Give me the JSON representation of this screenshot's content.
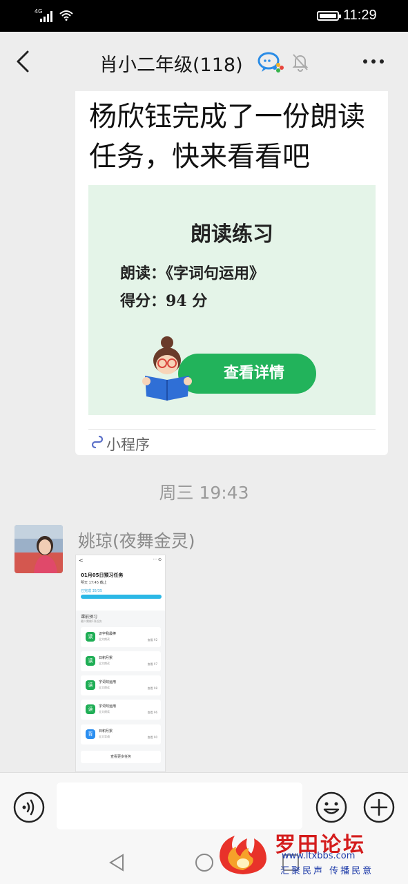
{
  "status_bar": {
    "network": "4G",
    "time": "11:29"
  },
  "header": {
    "title": "肖小二年级(118)"
  },
  "card": {
    "title": "杨欣钰完成了一份朗读任务，快来看看吧",
    "preview": {
      "heading": "朗读练习",
      "reading": "朗读：《字词句运用》",
      "score": "得分：94 分",
      "button": "查看详情"
    },
    "source_label": "小程序"
  },
  "timestamp": "周三 19:43",
  "message": {
    "sender": "姚琼(夜舞金灵)",
    "screenshot": {
      "back": "<",
      "caps": "··· ⊙",
      "title": "01月05日预习任务",
      "deadline": "明天 17:45 截止",
      "done": "已完成 35/35",
      "progress": 1.0,
      "section": "课前预习",
      "section_sub": "最少需做1项任务",
      "tasks": [
        {
          "name": "识字我最棒",
          "sub": "全文朗读",
          "score": "查看 92",
          "icon": "读",
          "color": "#1fae55"
        },
        {
          "name": "日积月累",
          "sub": "全文朗读",
          "score": "查看 97",
          "icon": "读",
          "color": "#1fae55"
        },
        {
          "name": "字词句运用",
          "sub": "全文朗读",
          "score": "查看 98",
          "icon": "读",
          "color": "#1fae55"
        },
        {
          "name": "字词句运用",
          "sub": "全文朗读",
          "score": "查看 96",
          "icon": "读",
          "color": "#1fae55"
        },
        {
          "name": "日积月累",
          "sub": "全文背诵",
          "score": "查看 90",
          "icon": "背",
          "color": "#2b8ef0"
        }
      ],
      "more": "查看更多任务"
    }
  },
  "input": {
    "placeholder": ""
  },
  "watermark": {
    "name": "罗田论坛",
    "site": "www.ltxbbs.com",
    "slogan": "汇聚民声 传播民意"
  },
  "colors": {
    "accent_green": "#22b35b",
    "wm_red": "#d41c1c",
    "wm_blue": "#1c3aa8"
  }
}
